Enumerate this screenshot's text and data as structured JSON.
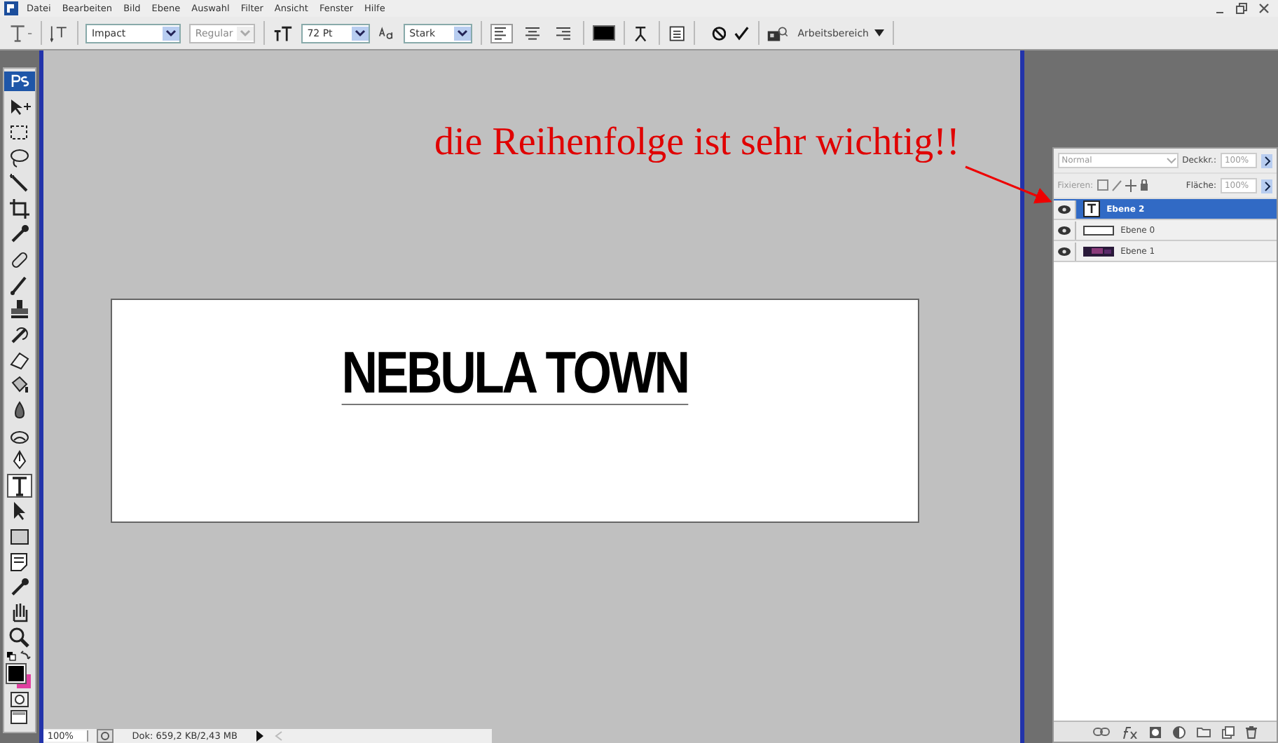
{
  "menu": [
    "Datei",
    "Bearbeiten",
    "Bild",
    "Ebene",
    "Auswahl",
    "Filter",
    "Ansicht",
    "Fenster",
    "Hilfe"
  ],
  "options": {
    "font_family": "Impact",
    "font_style": "Regular",
    "font_size": "72 Pt",
    "antialias": "Stark",
    "align": [
      {
        "kind": "left",
        "selected": true
      },
      {
        "kind": "center",
        "selected": false
      },
      {
        "kind": "right",
        "selected": false
      }
    ],
    "workspace": "Arbeitsbereich"
  },
  "tools": [
    {
      "kind": "move",
      "selected": false
    },
    {
      "kind": "marquee",
      "selected": false
    },
    {
      "kind": "lasso",
      "selected": false
    },
    {
      "kind": "wand",
      "selected": false
    },
    {
      "kind": "crop",
      "selected": false
    },
    {
      "kind": "eyedropper",
      "selected": false
    },
    {
      "kind": "healing",
      "selected": false
    },
    {
      "kind": "brush",
      "selected": false
    },
    {
      "kind": "stamp",
      "selected": false
    },
    {
      "kind": "history",
      "selected": false
    },
    {
      "kind": "eraser",
      "selected": false
    },
    {
      "kind": "bucket",
      "selected": false
    },
    {
      "kind": "blur",
      "selected": false
    },
    {
      "kind": "dodge",
      "selected": false
    },
    {
      "kind": "pen",
      "selected": false
    },
    {
      "kind": "type",
      "selected": true
    },
    {
      "kind": "select",
      "selected": false
    },
    {
      "kind": "shape",
      "selected": false
    },
    {
      "kind": "notes",
      "selected": false
    },
    {
      "kind": "eyedropper",
      "selected": false
    },
    {
      "kind": "hand",
      "selected": false
    },
    {
      "kind": "zoom",
      "selected": false
    }
  ],
  "document": {
    "text": "NEBULA TOWN"
  },
  "annotation": "die Reihenfolge ist sehr wichtig!!",
  "layers_panel": {
    "blend_mode": "Normal",
    "opacity_label": "Deckkr.:",
    "opacity": "100%",
    "lock_label": "Fixieren:",
    "fill_label": "Fläche:",
    "fill": "100%",
    "layers": [
      {
        "name": "Ebene 2",
        "kind": "text",
        "selected": true,
        "visible": true
      },
      {
        "name": "Ebene 0",
        "kind": "blank",
        "selected": false,
        "visible": true
      },
      {
        "name": "Ebene 1",
        "kind": "image",
        "selected": false,
        "visible": true
      }
    ]
  },
  "status": {
    "zoom": "100%",
    "info": "Dok: 659,2 KB/2,43 MB"
  }
}
